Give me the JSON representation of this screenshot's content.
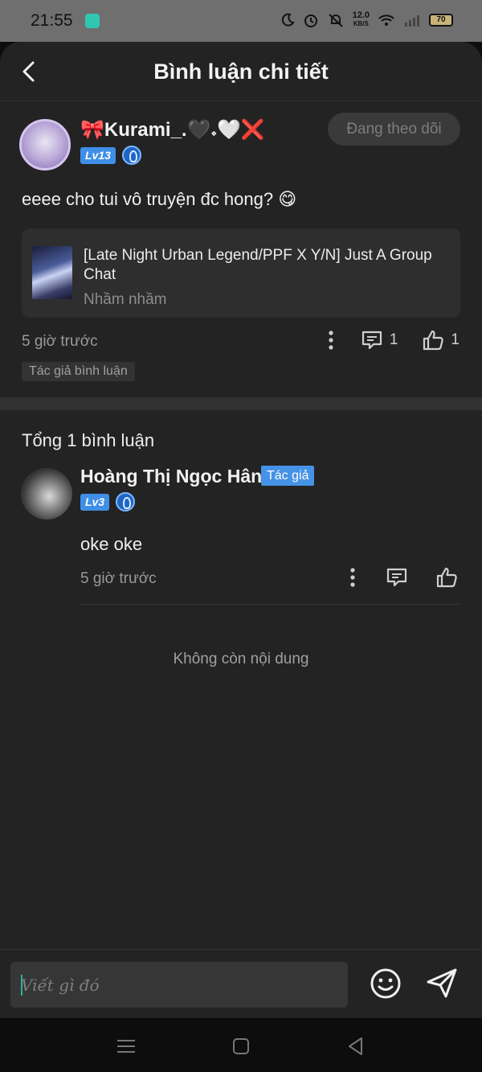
{
  "status_bar": {
    "time": "21:55",
    "net_speed_value": "12.0",
    "net_speed_unit": "KB/S",
    "battery": "70"
  },
  "header": {
    "title": "Bình luận chi tiết"
  },
  "post": {
    "username": "🎀Kurami_.🖤𝆹🤍❌",
    "level": "Lv13",
    "follow_label": "Đang theo dõi",
    "content": "eeee cho tui vô truyện đc hong? 😋",
    "story": {
      "title": "[Late Night Urban Legend/PPF X Y/N] Just A Group Chat",
      "author": "Nhầm nhầm"
    },
    "time": "5 giờ trước",
    "reply_count": "1",
    "like_count": "1",
    "tag": "Tác giả bình luận"
  },
  "comments": {
    "total_label": "Tổng 1 bình luận",
    "items": [
      {
        "name": "Hoàng Thị Ngọc Hân",
        "author_tag": "Tác giả",
        "level": "Lv3",
        "content": "oke oke",
        "time": "5 giờ trước"
      }
    ],
    "end_message": "Không còn nội dung"
  },
  "composer": {
    "placeholder": "Viết gì đó"
  },
  "colors": {
    "background": "#232323",
    "accent_blue": "#4592e6",
    "cursor": "#2bb3a0"
  }
}
